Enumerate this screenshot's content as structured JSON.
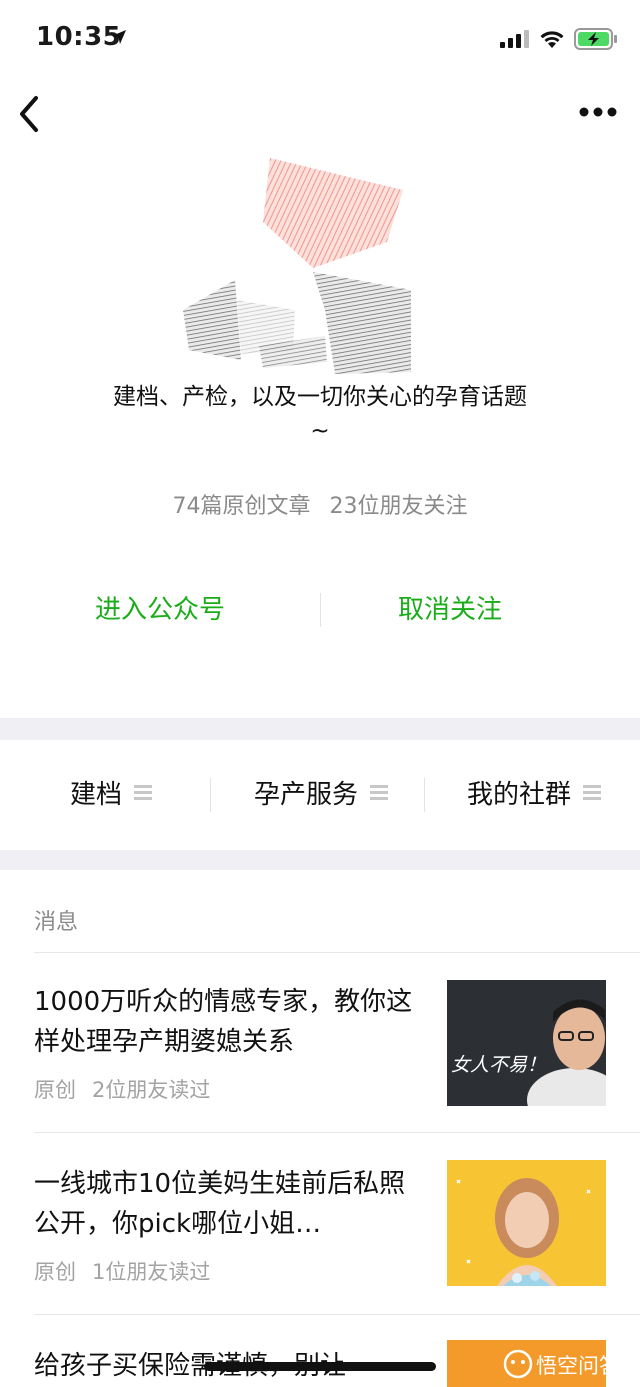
{
  "status_bar": {
    "time": "10:35"
  },
  "profile": {
    "description_line1": "建档、产检，以及一切你关心的孕育话题",
    "description_line2": "~",
    "original_articles": "74篇原创文章",
    "friends_following": "23位朋友关注",
    "enter_label": "进入公众号",
    "unfollow_label": "取消关注"
  },
  "menu": {
    "items": [
      {
        "label": "建档"
      },
      {
        "label": "孕产服务"
      },
      {
        "label": "我的社群"
      }
    ]
  },
  "messages": {
    "section_title": "消息",
    "articles": [
      {
        "title": "1000万听众的情感专家，教你这样处理孕产期婆媳关系",
        "tag": "原创",
        "reads": "2位朋友读过",
        "thumb_text": "女人不易！"
      },
      {
        "title": "一线城市10位美妈生娃前后私照公开，你pick哪位小姐…",
        "tag": "原创",
        "reads": "1位朋友读过"
      },
      {
        "title": "给孩子买保险需谨慎，别让"
      }
    ]
  },
  "watermark": {
    "text": "悟空问答"
  },
  "colors": {
    "accent_green": "#1aad19",
    "separator": "#efeff4",
    "meta_gray": "#a3a3a3"
  }
}
